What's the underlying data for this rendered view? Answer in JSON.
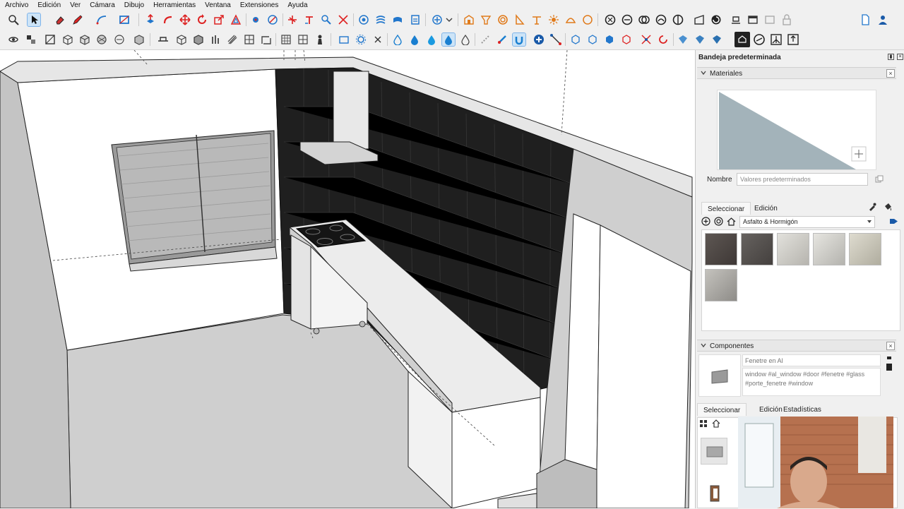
{
  "menu": [
    "Archivo",
    "Edición",
    "Ver",
    "Cámara",
    "Dibujo",
    "Herramientas",
    "Ventana",
    "Extensiones",
    "Ayuda"
  ],
  "toolbar1_icons": [
    "zoom-icon",
    "select-arrow-icon",
    "eraser-icon",
    "pencil-icon",
    "arc-icon",
    "rectangle-icon",
    "push-pull-icon",
    "follow-me-icon",
    "move-icon",
    "rotate-icon",
    "scale-icon",
    "offset-icon",
    "tape-measure-icon",
    "dimension-icon",
    "protractor-icon",
    "text-icon",
    "axes-icon",
    "section-plane-icon",
    "orbit-icon",
    "pan-icon",
    "zoom-window-icon",
    "zoom-extents-icon",
    "sandbox-icon",
    "solid-tools-icon",
    "walk-icon",
    "position-camera-icon",
    "look-around-icon",
    "paint-bucket-icon",
    "tag-icon",
    "new-file-icon",
    "user-icon"
  ],
  "toolbar2_icons": [
    "views-icon",
    "styles-icon",
    "xray-icon",
    "wireframe-icon",
    "hidden-line-icon",
    "shaded-icon",
    "textured-icon",
    "monochrome-icon",
    "section-display-icon",
    "components-icon",
    "groups-icon",
    "outliner-icon",
    "shadows-icon",
    "fog-icon",
    "materials-icon",
    "entity-info-icon",
    "scenes-icon",
    "water-drop-icon",
    "magnet-icon",
    "add-icon",
    "connector-icon",
    "box-icon",
    "randomize-icon",
    "ocl-icon",
    "export-icon"
  ],
  "tray": {
    "title": "Bandeja predeterminada",
    "materials": {
      "header": "Materiales",
      "name_label": "Nombre",
      "name_value": "Valores predeterminados",
      "tabs": [
        "Seleccionar",
        "Edición"
      ],
      "collection": "Asfalto & Hormigón",
      "swatches": [
        "#4a4442",
        "#55514f",
        "#d3d2cc",
        "#d6d5d0",
        "#d0cdc0",
        "#aaa8a3"
      ]
    },
    "components": {
      "header": "Componentes",
      "name_placeholder": "Fenetre en Al",
      "description": "window #al_window #door #fenetre #glass #porte_fenetre #window",
      "tabs": [
        "Seleccionar",
        "Edición",
        "Estadísticas"
      ]
    }
  }
}
